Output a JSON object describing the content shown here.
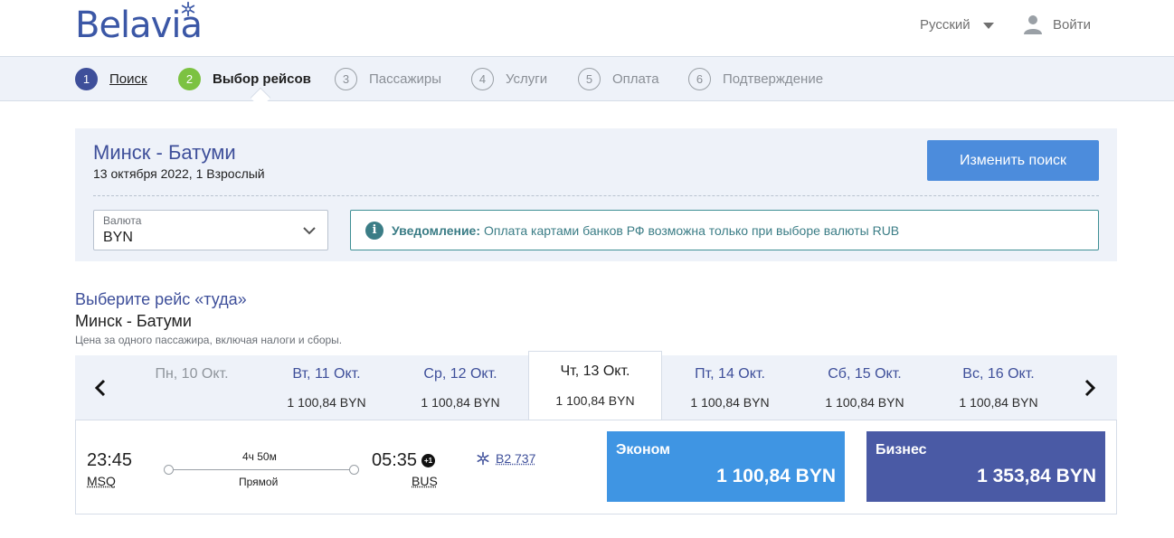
{
  "header": {
    "logo_text": "Belavia",
    "language": "Русский",
    "login_label": "Войти"
  },
  "steps": [
    {
      "num": "1",
      "label": "Поиск",
      "state": "done"
    },
    {
      "num": "2",
      "label": "Выбор рейсов",
      "state": "active"
    },
    {
      "num": "3",
      "label": "Пассажиры",
      "state": "pending"
    },
    {
      "num": "4",
      "label": "Услуги",
      "state": "pending"
    },
    {
      "num": "5",
      "label": "Оплата",
      "state": "pending"
    },
    {
      "num": "6",
      "label": "Подтверждение",
      "state": "pending"
    }
  ],
  "summary": {
    "route": "Минск - Батуми",
    "details": "13 октября 2022, 1 Взрослый",
    "change_button": "Изменить поиск",
    "currency_caption": "Валюта",
    "currency_value": "BYN",
    "notice_bold": "Уведомление:",
    "notice_text": "Оплата картами банков РФ возможна только при выборе валюты RUB"
  },
  "selection": {
    "title": "Выберите рейс «туда»",
    "route": "Минск - Батуми",
    "note": "Цена за одного пассажира, включая налоги и сборы."
  },
  "dates": [
    {
      "day": "Пн, 10 Окт.",
      "price": "",
      "state": "disabled"
    },
    {
      "day": "Вт, 11 Окт.",
      "price": "1 100,84 BYN",
      "state": "normal"
    },
    {
      "day": "Ср, 12 Окт.",
      "price": "1 100,84 BYN",
      "state": "normal"
    },
    {
      "day": "Чт, 13 Окт.",
      "price": "1 100,84 BYN",
      "state": "selected"
    },
    {
      "day": "Пт, 14 Окт.",
      "price": "1 100,84 BYN",
      "state": "normal"
    },
    {
      "day": "Сб, 15 Окт.",
      "price": "1 100,84 BYN",
      "state": "normal"
    },
    {
      "day": "Вс, 16 Окт.",
      "price": "1 100,84 BYN",
      "state": "normal"
    }
  ],
  "flight": {
    "departure_time": "23:45",
    "departure_code": "MSQ",
    "duration": "4ч 50м",
    "stops": "Прямой",
    "arrival_time": "05:35",
    "day_offset": "+1",
    "arrival_code": "BUS",
    "flight_number": "B2 737",
    "fares": [
      {
        "name": "Эконом",
        "price": "1 100,84 BYN",
        "color": "#3f95e3"
      },
      {
        "name": "Бизнес",
        "price": "1 353,84 BYN",
        "color": "#4a5aa5"
      }
    ]
  },
  "colors": {
    "brand": "#3b57a6",
    "step_active": "#7cc242",
    "step_done": "#3e4f9a",
    "button": "#4c8cdc",
    "notice": "#3b7d86"
  }
}
